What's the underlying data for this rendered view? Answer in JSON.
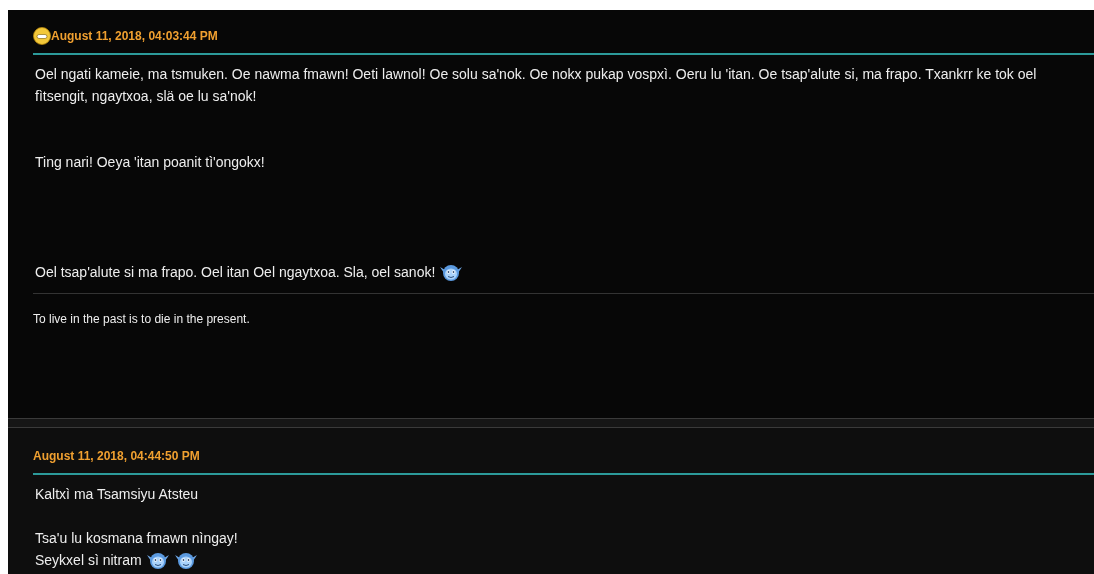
{
  "posts": [
    {
      "date": "August 11, 2018, 04:03:44 PM",
      "date_icon": true,
      "body": [
        {
          "kind": "text",
          "text": "Oel ngati kameie, ma tsmuken. Oe nawma fmawn! Oeti lawnol! Oe solu sa'nok. Oe nokx pukap vospxì. Oeru lu 'itan. Oe tsap'alute si, ma frapo. Txankrr ke tok oel fìtsengit, ngaytxoa, slä oe lu sa'nok!"
        },
        {
          "kind": "break"
        },
        {
          "kind": "break"
        },
        {
          "kind": "text",
          "text": "Ting nari! Oeya 'itan poanit tì'ongokx!"
        },
        {
          "kind": "break"
        },
        {
          "kind": "break"
        },
        {
          "kind": "break"
        },
        {
          "kind": "break"
        },
        {
          "kind": "text",
          "text": "Oel tsap'alute si ma frapo. Oel itan Oel ngaytxoa. Sla, oel sanok!",
          "emotes": [
            {
              "kind": "navi"
            }
          ]
        }
      ],
      "signature": "To live in the past is to die in the present."
    },
    {
      "date": "August 11, 2018, 04:44:50 PM",
      "date_icon": false,
      "body": [
        {
          "kind": "text",
          "text": "Kaltxì ma Tsamsiyu Atsteu"
        },
        {
          "kind": "break"
        },
        {
          "kind": "text",
          "text": "Tsa'u lu kosmana fmawn nìngay!"
        },
        {
          "kind": "text",
          "text": "Seykxel sì nitram",
          "emotes": [
            {
              "kind": "navi"
            },
            {
              "kind": "navi"
            }
          ]
        }
      ]
    }
  ]
}
